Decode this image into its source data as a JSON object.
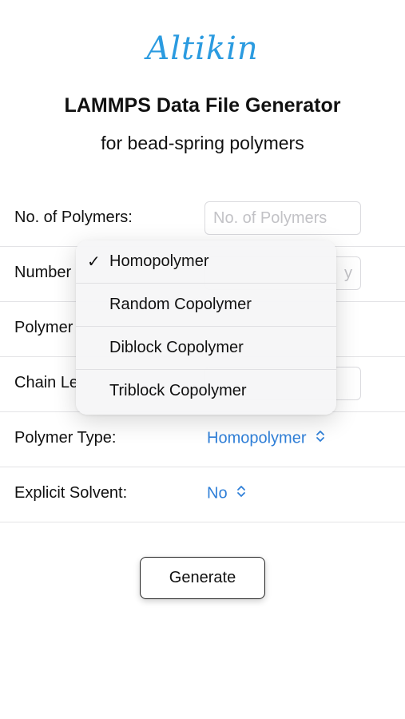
{
  "header": {
    "logo": "Altikin",
    "title": "LAMMPS Data File Generator",
    "subtitle": "for bead-spring polymers"
  },
  "form": {
    "rows": [
      {
        "label": "No. of Polymers:",
        "placeholder": "No. of Polymers"
      },
      {
        "label": "Number",
        "placeholder": "y"
      },
      {
        "label": "Polymer",
        "placeholder": ""
      },
      {
        "label": "Chain Le",
        "placeholder": ""
      },
      {
        "label": "Polymer Type:",
        "value": "Homopolymer"
      },
      {
        "label": "Explicit Solvent:",
        "value": "No"
      }
    ]
  },
  "menu": {
    "check_glyph": "✓",
    "items": [
      {
        "label": "Homopolymer",
        "selected": true
      },
      {
        "label": "Random Copolymer",
        "selected": false
      },
      {
        "label": "Diblock Copolymer",
        "selected": false
      },
      {
        "label": "Triblock Copolymer",
        "selected": false
      }
    ]
  },
  "actions": {
    "generate_label": "Generate"
  },
  "colors": {
    "logo": "#2b9be0",
    "picker": "#2f7fd8",
    "placeholder": "#c2c2c6"
  },
  "icons": {
    "picker_chevron": "chevron-up-down-icon",
    "checkmark": "checkmark-icon"
  }
}
